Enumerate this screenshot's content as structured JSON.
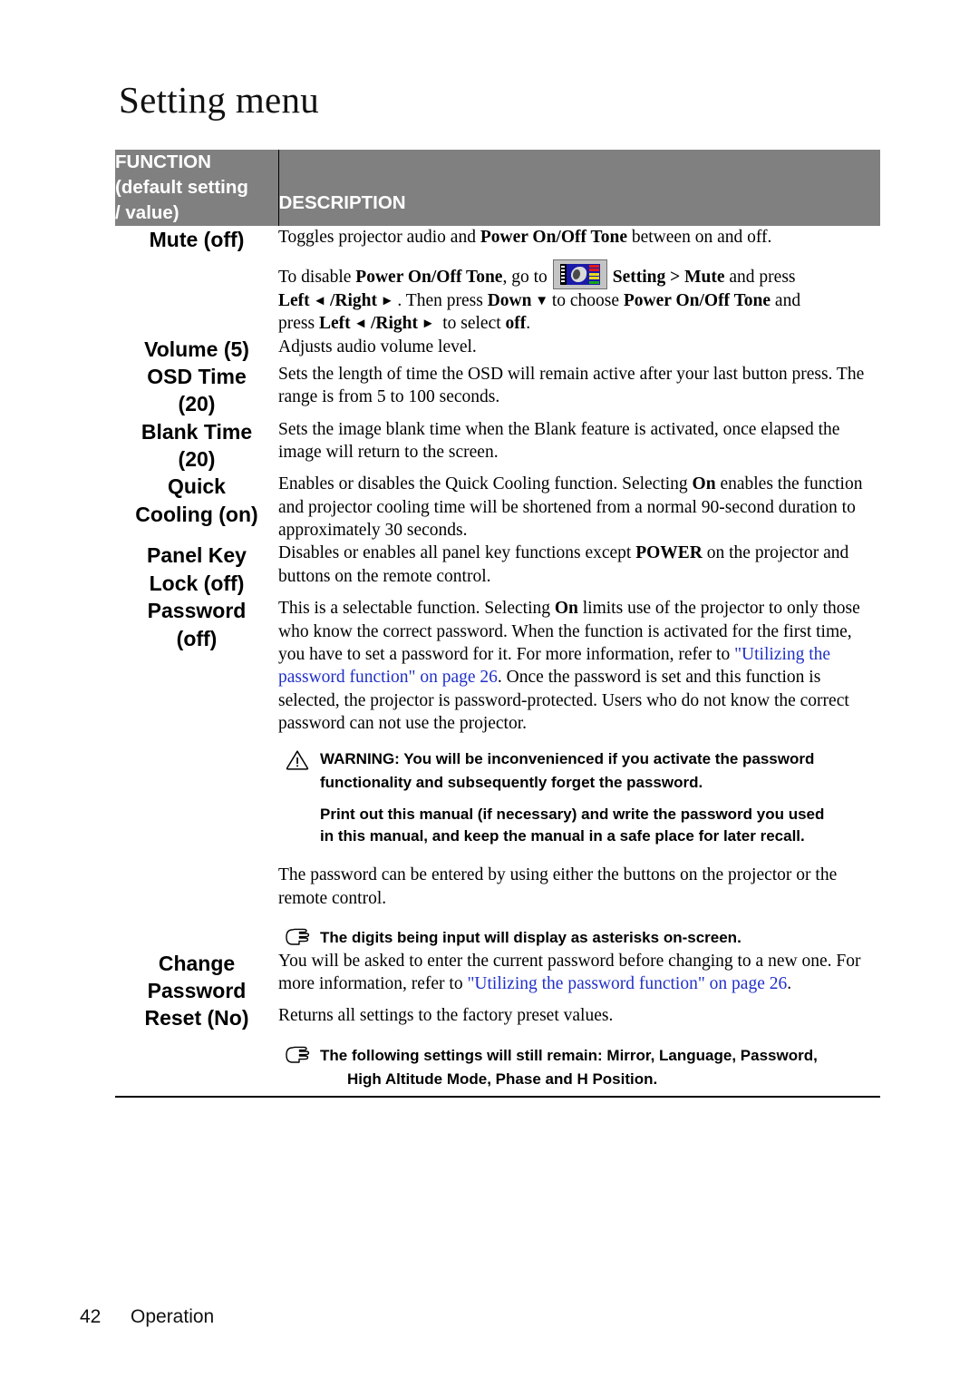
{
  "page": {
    "title": "Setting menu",
    "footer_page_number": "42",
    "footer_section": "Operation"
  },
  "table": {
    "headers": {
      "function": "FUNCTION (default setting / value)",
      "function_line1": "FUNCTION",
      "function_line2": "(default setting",
      "function_line3": "/ value)",
      "description": "DESCRIPTION"
    },
    "rows": [
      {
        "function": "Mute (off)",
        "paragraphs": [
          {
            "type": "rich",
            "segments": [
              {
                "t": "Toggles projector audio and ",
                "bold": false
              },
              {
                "t": "Power On/Off Tone",
                "bold": true
              },
              {
                "t": " between on and off.",
                "bold": false
              }
            ]
          },
          {
            "type": "rich-icon",
            "segments": [
              {
                "t": "To disable ",
                "bold": false
              },
              {
                "t": "Power On/Off Tone",
                "bold": true
              },
              {
                "t": ", go to ",
                "bold": false
              },
              {
                "t": "[osd-icon]",
                "icon": "setting-menu-icon"
              },
              {
                "t": "Setting",
                "bold": true
              },
              {
                "t": " > ",
                "bold": true
              },
              {
                "t": "Mute",
                "bold": true
              },
              {
                "t": " and press ",
                "bold": false
              },
              {
                "t": "Left",
                "bold": true
              },
              {
                "t": " ◄ ",
                "bold": false
              },
              {
                "t": "/Right",
                "bold": true
              },
              {
                "t": " ► ",
                "bold": false
              },
              {
                "t": ". Then press ",
                "bold": false
              },
              {
                "t": "Down",
                "bold": true
              },
              {
                "t": " ▼ ",
                "bold": false
              },
              {
                "t": "to choose ",
                "bold": false
              },
              {
                "t": "Power On/Off Tone",
                "bold": true
              },
              {
                "t": " and press ",
                "bold": false
              },
              {
                "t": "Left",
                "bold": true
              },
              {
                "t": " ◄ ",
                "bold": false
              },
              {
                "t": "/Right",
                "bold": true
              },
              {
                "t": " ► ",
                "bold": false
              },
              {
                "t": "to  select ",
                "bold": false
              },
              {
                "t": "off",
                "bold": true
              },
              {
                "t": ".",
                "bold": false
              }
            ]
          }
        ]
      },
      {
        "function": "Volume (5)",
        "paragraphs": [
          {
            "type": "plain",
            "text": "Adjusts audio volume level."
          }
        ]
      },
      {
        "function": "OSD Time (20)",
        "function_line1": "OSD Time",
        "function_line2": "(20)",
        "paragraphs": [
          {
            "type": "plain",
            "text": "Sets the length of time the OSD will remain active after your last button press. The range is from 5 to 100 seconds."
          }
        ]
      },
      {
        "function": "Blank Time (20)",
        "function_line1": "Blank Time",
        "function_line2": "(20)",
        "paragraphs": [
          {
            "type": "plain",
            "text": "Sets the image blank time when the Blank feature is activated, once elapsed the image will return to the screen."
          }
        ]
      },
      {
        "function": "Quick Cooling (on)",
        "function_line1": "Quick",
        "function_line2": "Cooling (on)",
        "paragraphs": [
          {
            "type": "plain",
            "text": "Enables or disables the Quick Cooling function. Selecting On enables the function and projector cooling time will be shortened from a normal 90-second duration to approximately 30 seconds."
          }
        ]
      },
      {
        "function": "Panel Key Lock (off)",
        "function_line1": "Panel Key",
        "function_line2": "Lock (off)",
        "paragraphs": [
          {
            "type": "plain",
            "text": "Disables or enables all panel key functions except POWER on the projector and buttons on the remote control."
          }
        ]
      },
      {
        "function": "Password (off)",
        "function_line1": "Password",
        "function_line2": "(off)",
        "paragraphs": [
          {
            "type": "plain",
            "text": "This is a selectable function. Selecting On limits use of the projector to only those who know the correct password. When the function is activated for the first time, you have to set a password for it. For more information, refer to \"Utilizing the password function\" on page 26. Once the password is set and this function is selected, the projector is password-protected. Users who do not know the correct password can not use the projector."
          },
          {
            "type": "warning",
            "line1": "WARNING: You will be inconvenienced if you activate the password",
            "line2": "functionality and subsequently forget the password.",
            "line3": "Print out this manual (if necessary) and write the password you used",
            "line4": "in this manual, and keep the manual in a safe place for later recall."
          },
          {
            "type": "plain",
            "text": "The password can be entered by using either the buttons on the projector or the remote control."
          },
          {
            "type": "note",
            "text": "The digits being input will display as asterisks on-screen."
          }
        ]
      },
      {
        "function": "Change Password",
        "function_line1": "Change",
        "function_line2": "Password",
        "paragraphs": [
          {
            "type": "plain",
            "text": "You will be asked to enter the current password before changing to a new one. For more information, refer to \"Utilizing the password function\" on page 26."
          }
        ]
      },
      {
        "function": "Reset (No)",
        "paragraphs": [
          {
            "type": "plain",
            "text": "Returns all settings to the factory preset values."
          },
          {
            "type": "note",
            "line1": "The following settings will still remain: Mirror, Language, Password,",
            "line2": "High Altitude Mode, Phase and H Position."
          }
        ]
      }
    ]
  },
  "text": {
    "mute_p1_a": "Toggles projector audio and ",
    "mute_p1_b": "Power On/Off Tone",
    "mute_p1_c": " between on and off.",
    "mute_p2_a": "To disable ",
    "mute_p2_b": "Power On/Off Tone",
    "mute_p2_c": ", go to",
    "mute_p2_d": "Setting",
    "mute_p2_gt": " > ",
    "mute_p2_e": "Mute",
    "mute_p2_f": " and press",
    "mute_p3_left": "Left",
    "mute_p3_right": "/Right",
    "mute_p3_then": ". Then press ",
    "mute_p3_down": "Down",
    "mute_p3_tochoose": "to choose ",
    "mute_p3_tone": "Power On/Off Tone",
    "mute_p3_and": " and",
    "mute_p4_press": "press ",
    "mute_p4_left": "Left",
    "mute_p4_right": "/Right",
    "mute_p4_to": " to  select ",
    "mute_p4_off": "off",
    "mute_p4_dot": ".",
    "volume_desc": "Adjusts audio volume level.",
    "osdtime_desc": "Sets the length of time the OSD will remain active after your last button press. The range is from 5 to 100 seconds.",
    "blanktime_desc": "Sets the image blank time when the Blank feature is activated, once elapsed the image will return to the screen.",
    "quick_a": "Enables or disables the Quick Cooling function. Selecting ",
    "quick_on": "On",
    "quick_b": " enables the function and projector cooling time will be shortened from a normal 90-second duration to approximately 30 seconds.",
    "panel_a": "Disables or enables all panel key functions except ",
    "panel_power": "POWER",
    "panel_b": " on the projector and buttons on the remote control.",
    "pwd_a": "This is a selectable function. Selecting ",
    "pwd_on": "On",
    "pwd_b": " limits use of the projector to only those who know the correct password. When the function is activated for the first time, you have to set a password for it. For more information, refer to ",
    "pwd_link": "\"Utilizing the password function\" on page 26",
    "pwd_c": ". Once the password is set and this function is selected, the projector is password-protected. Users who do not know the correct password can not use the projector.",
    "warn_l1": "WARNING: You will be inconvenienced if you activate the password",
    "warn_l2": "functionality and subsequently forget the password.",
    "warn_l3": "Print out this manual (if necessary) and write the password you used",
    "warn_l4": "in this manual, and keep the manual in a safe place for later recall.",
    "pwd_entered": "The password can be entered by using either the buttons on the projector or the remote control.",
    "note_digits": "The digits being input will display as asterisks on-screen.",
    "chg_a": "You will be asked to enter the current password before changing to a new one. For more information, refer to ",
    "chg_link": "\"Utilizing the password function\" on page 26",
    "chg_c": ".",
    "reset_desc": "Returns all settings to the factory preset values.",
    "reset_note_l1": "The following settings will still remain: Mirror, Language, Password,",
    "reset_note_l2": "High Altitude Mode, Phase and H Position."
  },
  "colors": {
    "header_bg": "#808080",
    "header_text": "#ffffff",
    "link": "#2030c8",
    "body_text": "#000000"
  }
}
